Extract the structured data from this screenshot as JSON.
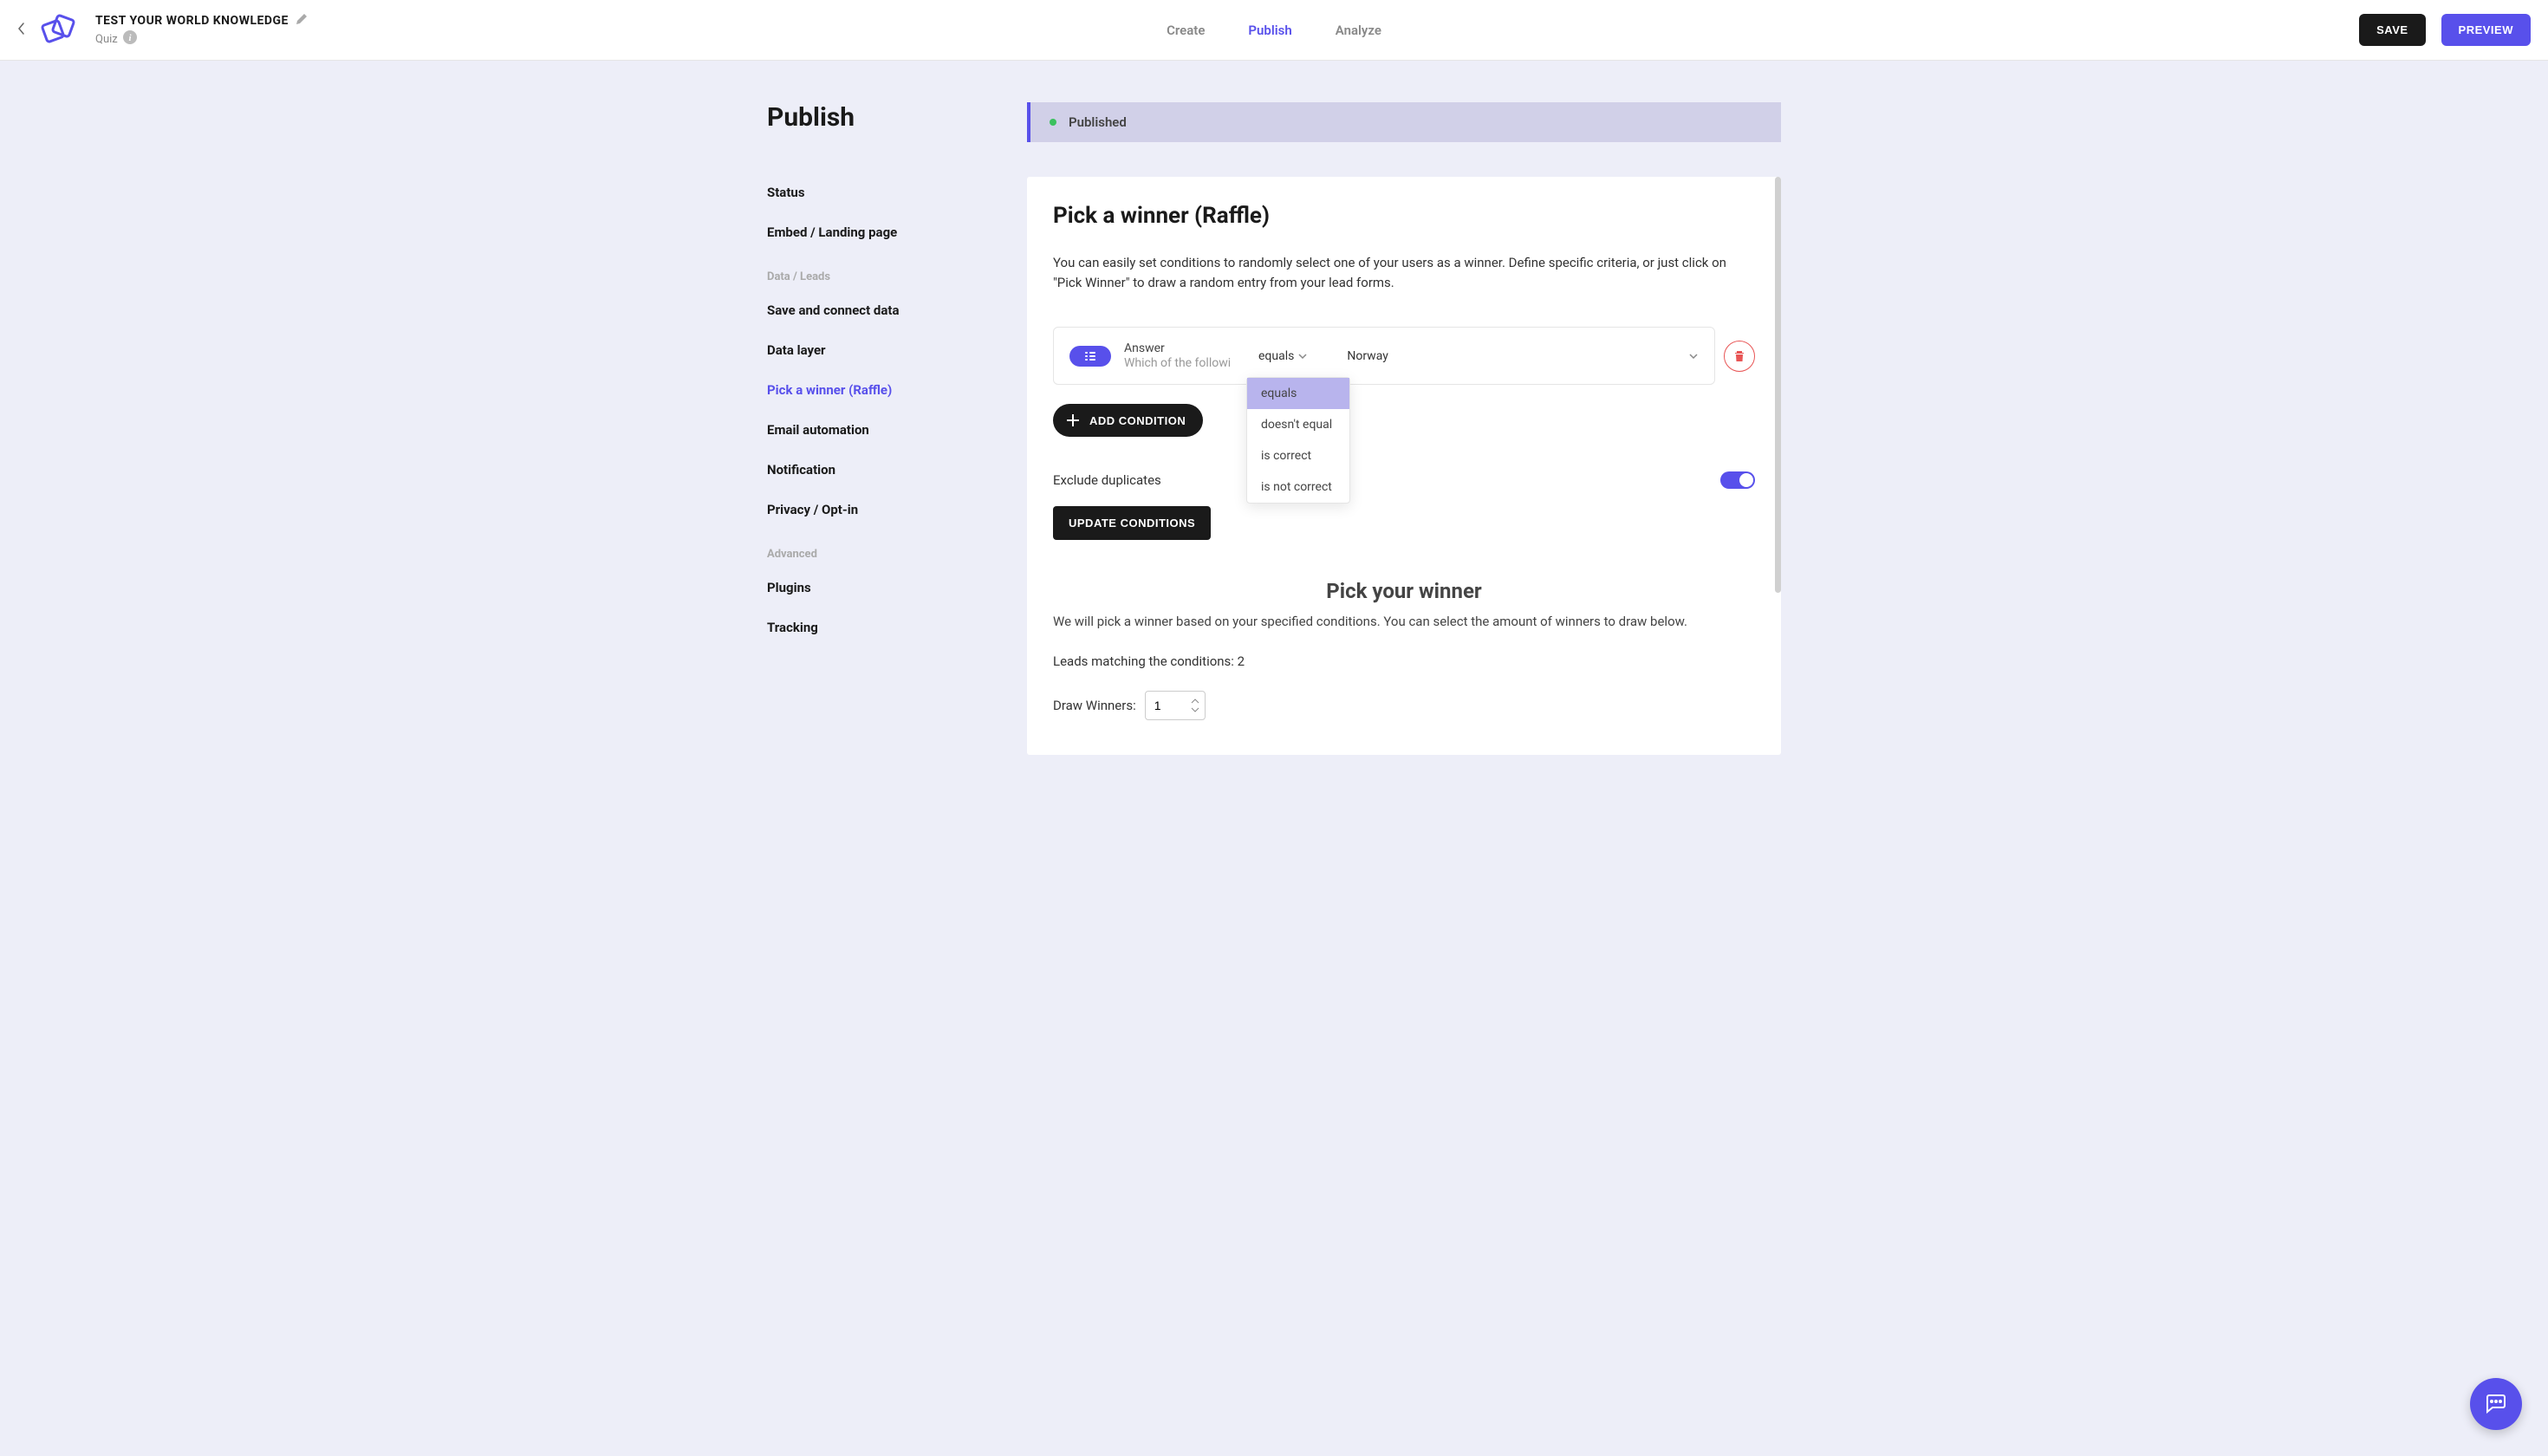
{
  "header": {
    "project_title": "TEST YOUR WORLD KNOWLEDGE",
    "subtitle": "Quiz",
    "tabs": {
      "create": "Create",
      "publish": "Publish",
      "analyze": "Analyze"
    },
    "save_label": "SAVE",
    "preview_label": "PREVIEW"
  },
  "sidebar": {
    "page_title": "Publish",
    "items": {
      "status": "Status",
      "embed": "Embed / Landing page"
    },
    "data_section": {
      "heading": "Data / Leads",
      "save_connect": "Save and connect data",
      "data_layer": "Data layer",
      "pick_winner": "Pick a winner (Raffle)",
      "email_automation": "Email automation",
      "notification": "Notification",
      "privacy": "Privacy / Opt-in"
    },
    "advanced_section": {
      "heading": "Advanced",
      "plugins": "Plugins",
      "tracking": "Tracking"
    }
  },
  "status_bar": {
    "text": "Published"
  },
  "card": {
    "title": "Pick a winner (Raffle)",
    "description": "You can easily set conditions to randomly select one of your users as a winner. Define specific criteria, or just click on \"Pick Winner\" to draw a random entry from your lead forms.",
    "condition": {
      "answer_label": "Answer",
      "answer_question": "Which of the followi",
      "operator": "equals",
      "value": "Norway"
    },
    "operator_options": {
      "equals": "equals",
      "doesnt_equal": "doesn't equal",
      "is_correct": "is correct",
      "is_not_correct": "is not correct"
    },
    "add_condition_label": "ADD CONDITION",
    "exclude_duplicates_label": "Exclude duplicates",
    "update_conditions_label": "UPDATE CONDITIONS",
    "pick_section": {
      "title": "Pick your winner",
      "description": "We will pick a winner based on your specified conditions. You can select the amount of winners to draw below.",
      "leads_matching": "Leads matching the conditions: 2",
      "draw_label": "Draw Winners:",
      "draw_count": "1"
    }
  }
}
